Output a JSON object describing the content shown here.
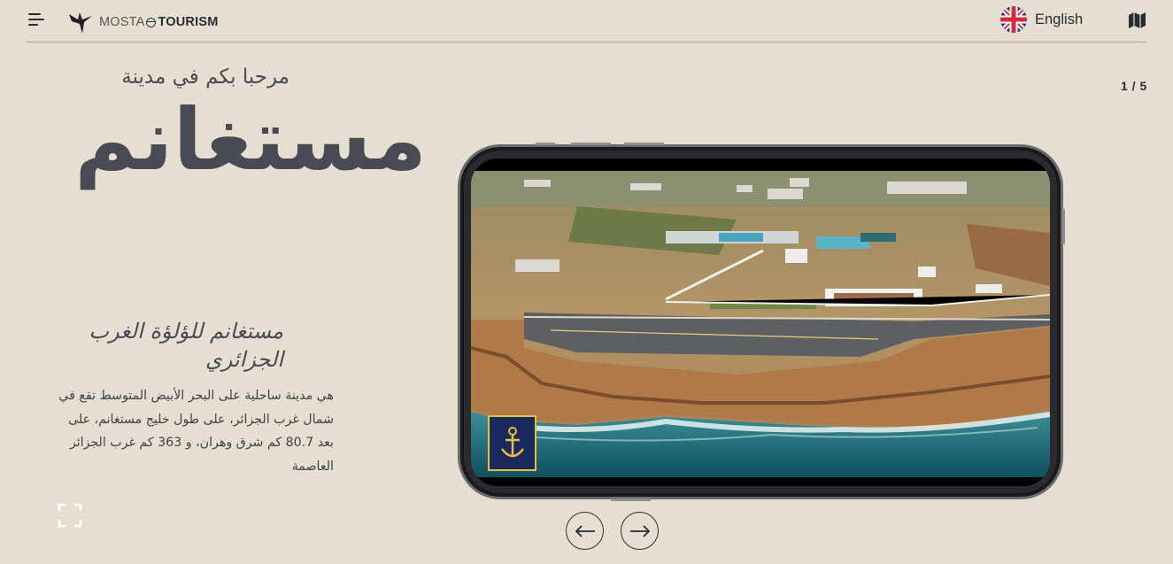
{
  "header": {
    "logo_text_light": "MOSTA",
    "logo_text_bold": "TOURISM",
    "language": "English"
  },
  "slider": {
    "counter": "1 / 5"
  },
  "hero": {
    "welcome": "مرحبا بكم في مدينة",
    "city": "مستغانم"
  },
  "section": {
    "subtitle": "مستغانم للؤلؤة الغرب الجزائري",
    "description": "هي مدينة ساحلية على البحر الأبيض المتوسط تقع في شمال غرب الجزائر، على طول خليج مستغانم، على بعد 80.7 كم شرق وهران، و 363 كم غرب الجزائر العاصمة"
  },
  "icons": {
    "menu": "menu-icon",
    "logo": "swallow-bird-logo",
    "flag": "uk-flag-icon",
    "map": "map-icon",
    "fullscreen": "fullscreen-icon",
    "prev": "arrow-left-icon",
    "next": "arrow-right-icon",
    "badge": "anchor-emblem"
  },
  "colors": {
    "background": "#e6dfd1",
    "text": "#4a4a54",
    "badge_border": "#e3c23a",
    "badge_bg": "#1b2a5e"
  }
}
